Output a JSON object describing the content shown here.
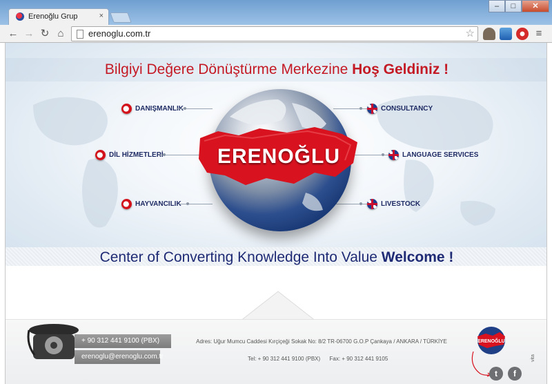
{
  "browser": {
    "tab_title": "Erenoğlu Grup",
    "tab_close": "×",
    "url": "erenoglu.com.tr",
    "back_icon": "←",
    "forward_icon": "→",
    "reload_icon": "↻",
    "home_icon": "⌂",
    "star_icon": "☆",
    "menu_icon": "≡",
    "minimize": "–",
    "maximize": "□",
    "close": "✕"
  },
  "hero": {
    "title_regular": "Bilgiyi Değere Dönüştürme Merkezine ",
    "title_bold": "Hoş Geldiniz !",
    "brand": "ERENOĞLU",
    "left_items": [
      {
        "label": "DANIŞMANLIK"
      },
      {
        "label": "DİL HİZMETLERİ"
      },
      {
        "label": "HAYVANCILIK"
      }
    ],
    "right_items": [
      {
        "label": "CONSULTANCY"
      },
      {
        "label": "LANGUAGE SERVICES"
      },
      {
        "label": "LIVESTOCK"
      }
    ],
    "subtitle_regular": "Center of Converting Knowledge Into Value ",
    "subtitle_bold": "Welcome !"
  },
  "footer": {
    "phone": "+ 90 312 441 9100 (PBX)",
    "email": "erenoglu@erenoglu.com.tr",
    "address": "Adres: Uğur Mumcu Caddesi Kırçiçeği Sokak No: 8/2 TR-06700 G.O.P Çankaya / ANKARA / TÜRKİYE",
    "tel": "Tel: + 90 312 441 9100 (PBX)",
    "fax": "Fax: + 90 312 441 9105",
    "logo_text": "ERENOĞLU",
    "twitter_icon": "t",
    "facebook_icon": "f",
    "byline": "vita"
  },
  "colors": {
    "red": "#c41a25",
    "navy": "#1e2a74"
  }
}
